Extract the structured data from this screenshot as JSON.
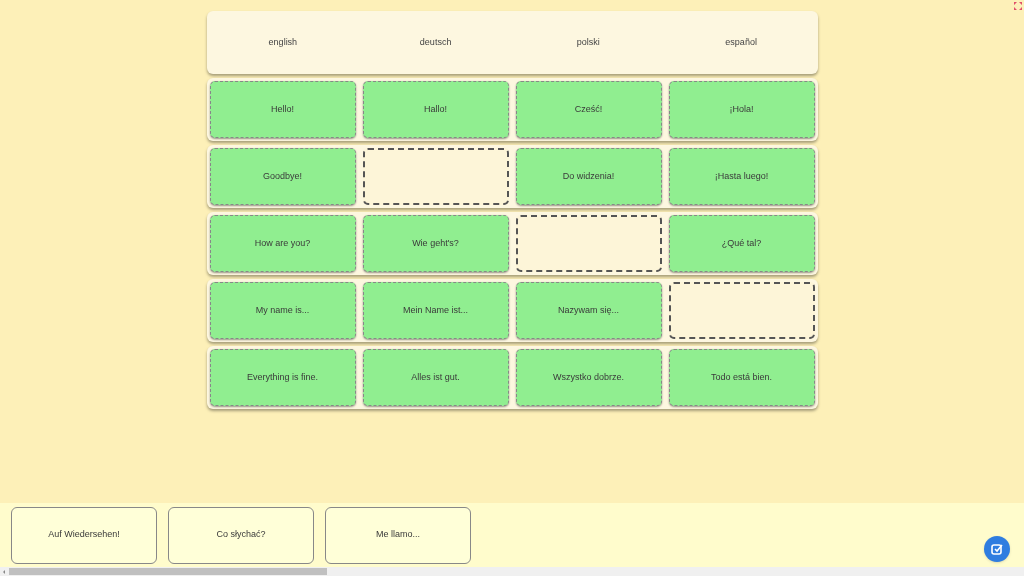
{
  "languages": [
    "english",
    "deutsch",
    "polski",
    "español"
  ],
  "rows": [
    {
      "cells": [
        {
          "kind": "filled",
          "text": "Hello!"
        },
        {
          "kind": "filled",
          "text": "Hallo!"
        },
        {
          "kind": "filled",
          "text": "Cześć!"
        },
        {
          "kind": "filled",
          "text": "¡Hola!"
        }
      ]
    },
    {
      "cells": [
        {
          "kind": "filled",
          "text": "Goodbye!"
        },
        {
          "kind": "empty"
        },
        {
          "kind": "filled",
          "text": "Do widzenia!"
        },
        {
          "kind": "filled",
          "text": "¡Hasta luego!"
        }
      ]
    },
    {
      "cells": [
        {
          "kind": "filled",
          "text": "How are you?"
        },
        {
          "kind": "filled",
          "text": "Wie geht's?"
        },
        {
          "kind": "empty"
        },
        {
          "kind": "filled",
          "text": "¿Qué tal?"
        }
      ]
    },
    {
      "cells": [
        {
          "kind": "filled",
          "text": "My name is..."
        },
        {
          "kind": "filled",
          "text": "Mein Name ist..."
        },
        {
          "kind": "filled",
          "text": "Nazywam się..."
        },
        {
          "kind": "empty"
        }
      ]
    },
    {
      "cells": [
        {
          "kind": "filled",
          "text": "Everything is fine."
        },
        {
          "kind": "filled",
          "text": "Alles ist gut."
        },
        {
          "kind": "filled",
          "text": "Wszystko dobrze."
        },
        {
          "kind": "filled",
          "text": "Todo está bien."
        }
      ]
    }
  ],
  "tray": [
    "Auf Wiedersehen!",
    "Co słychać?",
    "Me llamo..."
  ]
}
